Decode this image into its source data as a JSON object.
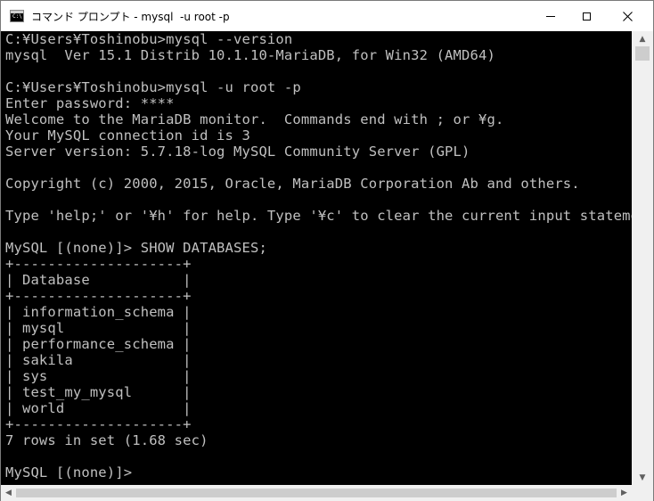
{
  "window": {
    "title": "コマンド プロンプト - mysql  -u root -p",
    "icon": "console-icon",
    "controls": {
      "minimize": "minimize-icon",
      "maximize": "maximize-icon",
      "close": "close-icon"
    }
  },
  "console": {
    "lines": [
      "C:¥Users¥Toshinobu>mysql --version",
      "mysql  Ver 15.1 Distrib 10.1.10-MariaDB, for Win32 (AMD64)",
      "",
      "C:¥Users¥Toshinobu>mysql -u root -p",
      "Enter password: ****",
      "Welcome to the MariaDB monitor.  Commands end with ; or ¥g.",
      "Your MySQL connection id is 3",
      "Server version: 5.7.18-log MySQL Community Server (GPL)",
      "",
      "Copyright (c) 2000, 2015, Oracle, MariaDB Corporation Ab and others.",
      "",
      "Type 'help;' or '¥h' for help. Type '¥c' to clear the current input statement.",
      "",
      "MySQL [(none)]> SHOW DATABASES;",
      "+--------------------+",
      "| Database           |",
      "+--------------------+",
      "| information_schema |",
      "| mysql              |",
      "| performance_schema |",
      "| sakila             |",
      "| sys                |",
      "| test_my_mysql      |",
      "| world              |",
      "+--------------------+",
      "7 rows in set (1.68 sec)",
      "",
      "MySQL [(none)]>"
    ]
  },
  "colors": {
    "console_bg": "#000000",
    "console_text": "#c0c0c0",
    "close_hover": "#e81123"
  }
}
